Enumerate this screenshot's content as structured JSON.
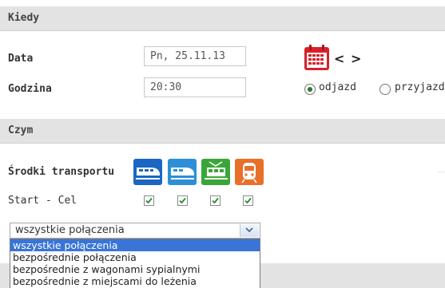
{
  "sections": {
    "when": {
      "title": "Kiedy"
    },
    "how": {
      "title": "Czym"
    }
  },
  "date": {
    "label": "Data",
    "value": "Pn, 25.11.13"
  },
  "time": {
    "label": "Godzina",
    "value": "20:30"
  },
  "calendar": {
    "icon": "calendar-icon",
    "prev_label": "<",
    "next_label": ">"
  },
  "direction": {
    "options": [
      {
        "label": "odjazd",
        "selected": true
      },
      {
        "label": "przyjazd",
        "selected": false
      }
    ]
  },
  "transport": {
    "label": "Środki transportu",
    "icons": [
      "intercity-train-icon",
      "express-train-icon",
      "regional-train-icon",
      "local-train-icon"
    ],
    "colors": [
      "#1a66c2",
      "#2c8fd8",
      "#3aa63a",
      "#e8702a"
    ]
  },
  "start_cel": {
    "label": "Start - Cel",
    "checked": [
      true,
      true,
      true,
      true
    ]
  },
  "connections": {
    "selected": "wszystkie połączenia",
    "options": [
      "wszystkie połączenia",
      "bezpośrednie połączenia",
      "bezpośrednie z wagonami sypialnymi",
      "bezpośrednie z miejscami do leżenia"
    ]
  }
}
